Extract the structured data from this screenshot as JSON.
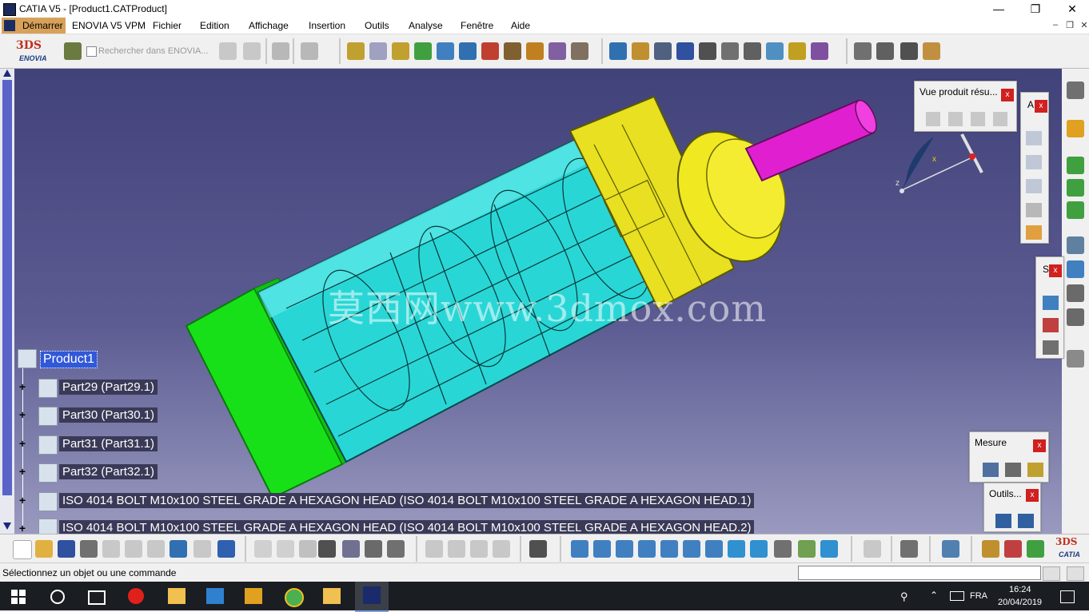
{
  "window": {
    "title": "CATIA V5 - [Product1.CATProduct]"
  },
  "menu": {
    "start": "Démarrer",
    "items": [
      "ENOVIA V5 VPM",
      "Fichier",
      "Edition",
      "Affichage",
      "Insertion",
      "Outils",
      "Analyse",
      "Fenêtre",
      "Aide"
    ]
  },
  "toolbar": {
    "search_placeholder": "Rechercher dans ENOVIA..."
  },
  "logos": {
    "enovia": "ENOVIA",
    "catia": "CATIA"
  },
  "tree": {
    "root": "Product1",
    "nodes": [
      "Part29 (Part29.1)",
      "Part30 (Part30.1)",
      "Part31 (Part31.1)",
      "Part32 (Part32.1)",
      "ISO 4014 BOLT M10x100 STEEL GRADE A HEXAGON HEAD (ISO 4014 BOLT M10x100 STEEL GRADE A HEXAGON HEAD.1)",
      "ISO 4014 BOLT M10x100 STEEL GRADE A HEXAGON HEAD (ISO 4014 BOLT M10x100 STEEL GRADE A HEXAGON HEAD.2)"
    ]
  },
  "panels": {
    "vue_produit": "Vue produit résu...",
    "a_panel": "A",
    "s_panel": "S",
    "mesure": "Mesure",
    "outils": "Outils...",
    "close": "x"
  },
  "watermark": "莫西网www.3dmox.com",
  "compass": {
    "x": "x",
    "z": "z"
  },
  "status": {
    "message": "Sélectionnez un objet ou une commande",
    "command_value": ""
  },
  "taskbar": {
    "lang": "FRA",
    "time": "16:24",
    "date": "20/04/2019"
  },
  "colors": {
    "viewport_top": "#42427a",
    "viewport_bottom": "#9a9ac0",
    "cyan_part": "#29d6d6",
    "yellow_part": "#e8e020",
    "green_part": "#20e020",
    "magenta_part": "#e020d0",
    "menu_start": "#d7a15a"
  },
  "icons": [
    "gear-icon",
    "select-arrow-icon",
    "fly-icon",
    "zoom-in-icon",
    "zoom-out-icon",
    "rotate-icon",
    "pan-icon",
    "measure-icon",
    "camera-icon",
    "undo-icon",
    "redo-icon",
    "save-icon",
    "print-icon",
    "cut-icon",
    "copy-icon",
    "paste-icon",
    "new-icon",
    "open-icon",
    "formula-icon",
    "help-icon"
  ]
}
